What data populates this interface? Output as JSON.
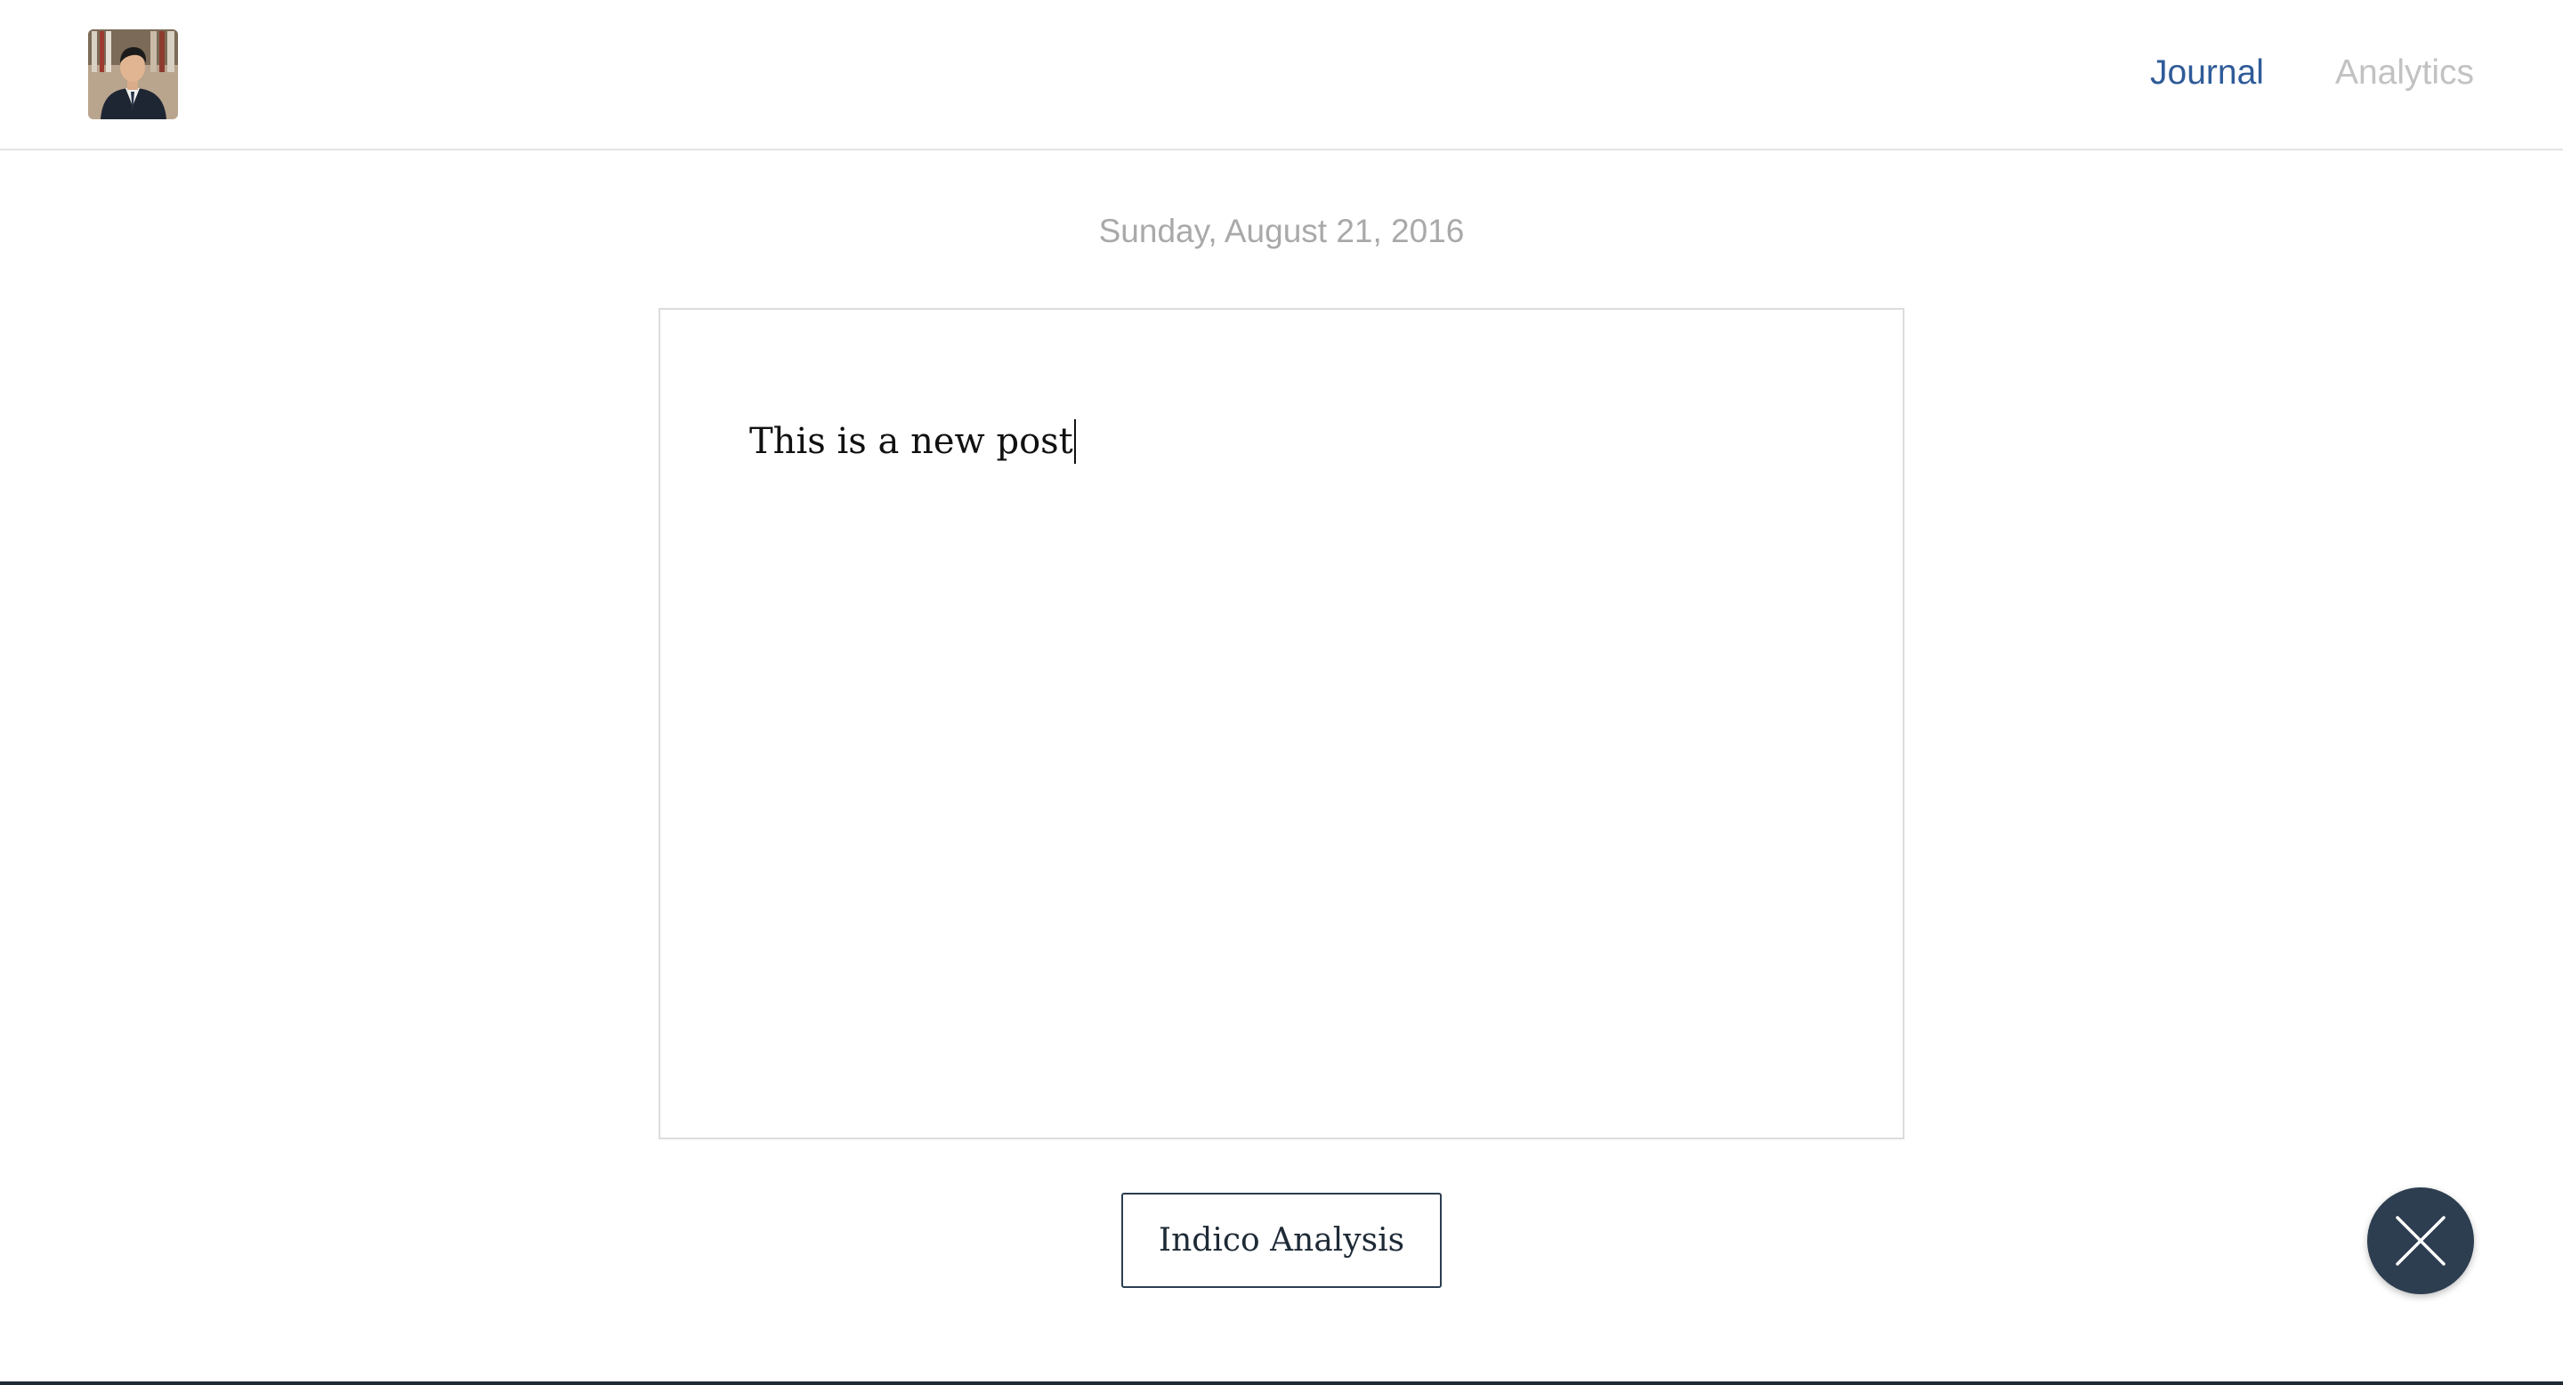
{
  "header": {
    "avatar_alt": "profile photo",
    "nav": {
      "journal_label": "Journal",
      "analytics_label": "Analytics"
    }
  },
  "main": {
    "date": "Sunday, August 21, 2016",
    "editor": {
      "text": "This is a new post"
    },
    "analyze_button_label": "Indico Analysis"
  },
  "fab": {
    "icon": "close-icon"
  },
  "colors": {
    "nav_active": "#2f5b98",
    "nav_inactive": "#c2c2c2",
    "date_text": "#a9a9a9",
    "fab_background": "#2d3e50",
    "button_border": "#2c3e50"
  }
}
